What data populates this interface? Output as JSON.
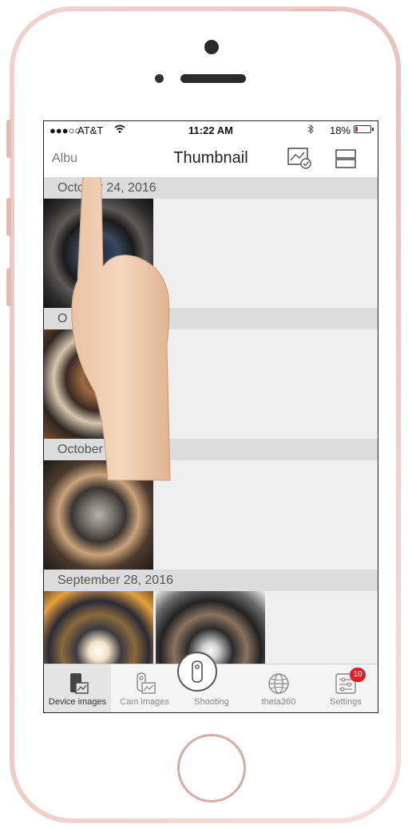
{
  "status_bar": {
    "signal": "●●●○○",
    "carrier": "AT&T",
    "wifi_icon": "wifi-icon",
    "time": "11:22 AM",
    "bluetooth_icon": "bluetooth-icon",
    "battery_percent": "18%",
    "battery_level": 0.18
  },
  "navbar": {
    "back_label": "Albu",
    "title": "Thumbnail",
    "icons": [
      "select-images-icon",
      "list-view-icon"
    ]
  },
  "sections": [
    {
      "date": "October 24, 2016",
      "thumbs": 1
    },
    {
      "date": "O",
      "thumbs": 1
    },
    {
      "date": "October 6, 2016",
      "thumbs": 1
    },
    {
      "date": "September 28, 2016",
      "thumbs": 2
    }
  ],
  "tabbar": {
    "items": [
      {
        "label": "Device images",
        "icon": "device-images-icon",
        "active": true
      },
      {
        "label": "Cam images",
        "icon": "cam-images-icon",
        "active": false
      },
      {
        "label": "Shooting",
        "icon": "shooting-icon",
        "active": false
      },
      {
        "label": "theta360",
        "icon": "globe-icon",
        "active": false
      },
      {
        "label": "Settings",
        "icon": "settings-icon",
        "active": false
      }
    ],
    "settings_badge": "10"
  },
  "colors": {
    "phone_frame": "#e8c1bb",
    "badge": "#d9232a",
    "battery_low": "#e0222a"
  }
}
